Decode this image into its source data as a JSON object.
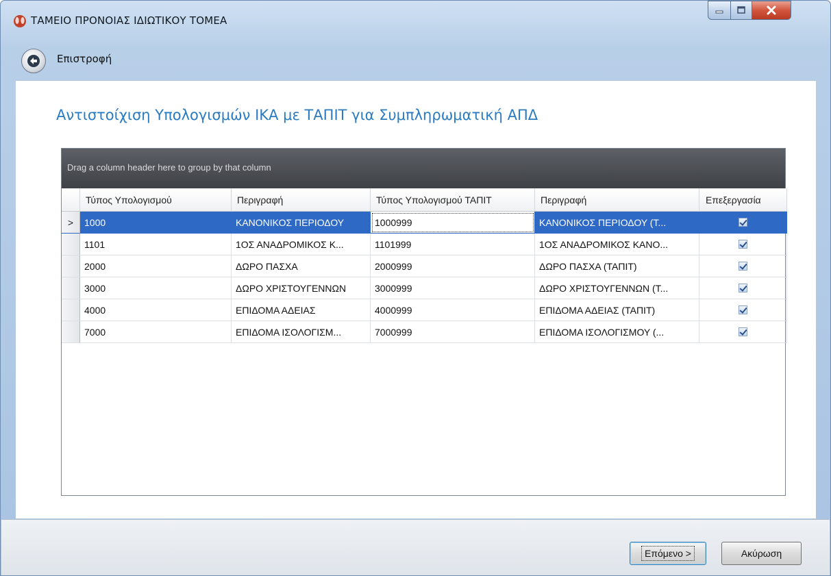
{
  "window": {
    "title": "ΤΑΜΕΙΟ ΠΡΟΝΟΙΑΣ ΙΔΙΩΤΙΚΟΥ ΤΟΜΕΑ",
    "icon": "app-logo-icon",
    "controls": {
      "minimize": "minimize-icon",
      "maximize": "maximize-icon",
      "close": "close-icon"
    }
  },
  "nav": {
    "back_label": "Επιστροφή",
    "back_icon": "back-arrow-icon"
  },
  "page": {
    "heading": "Αντιστοίχιση Υπολογισμών ΙΚΑ με ΤΑΠΙΤ για Συμπληρωματική  ΑΠΔ"
  },
  "grid": {
    "group_panel_text": "Drag a column header here to group by that column",
    "columns": [
      "Τύπος Υπολογισμού",
      "Περιγραφή",
      "Τύπος Υπολογισμού  ΤΑΠΙΤ",
      "Περιγραφή",
      "Επεξεργασία"
    ],
    "selected_row_indicator": ">",
    "rows": [
      {
        "code": "1000",
        "desc": "ΚΑΝΟΝΙΚΟΣ ΠΕΡΙΟΔΟΥ",
        "tapit_code": "1000999",
        "tapit_desc": "ΚΑΝΟΝΙΚΟΣ ΠΕΡΙΟΔΟΥ (Τ...",
        "edit": true
      },
      {
        "code": "1101",
        "desc": "1ΟΣ ΑΝΑΔΡΟΜΙΚΟΣ Κ...",
        "tapit_code": "1101999",
        "tapit_desc": "1ΟΣ ΑΝΑΔΡΟΜΙΚΟΣ ΚΑΝΟ...",
        "edit": true
      },
      {
        "code": "2000",
        "desc": "ΔΩΡΟ ΠΑΣΧΑ",
        "tapit_code": "2000999",
        "tapit_desc": "ΔΩΡΟ ΠΑΣΧΑ (ΤΑΠΙΤ)",
        "edit": true
      },
      {
        "code": "3000",
        "desc": "ΔΩΡΟ ΧΡΙΣΤΟΥΓΕΝΝΩΝ",
        "tapit_code": "3000999",
        "tapit_desc": "ΔΩΡΟ ΧΡΙΣΤΟΥΓΕΝΝΩΝ (Τ...",
        "edit": true
      },
      {
        "code": "4000",
        "desc": "ΕΠΙΔΟΜΑ ΑΔΕΙΑΣ",
        "tapit_code": "4000999",
        "tapit_desc": "ΕΠΙΔΟΜΑ ΑΔΕΙΑΣ (ΤΑΠΙΤ)",
        "edit": true
      },
      {
        "code": "7000",
        "desc": "ΕΠΙΔΟΜΑ ΙΣΟΛΟΓΙΣΜ...",
        "tapit_code": "7000999",
        "tapit_desc": "ΕΠΙΔΟΜΑ ΙΣΟΛΟΓΙΣΜΟΥ (...",
        "edit": true
      }
    ]
  },
  "footer": {
    "next_label": "Επόμενο >",
    "cancel_label": "Ακύρωση"
  },
  "colors": {
    "heading": "#2a7bc2",
    "selected_row": "#2f69c6",
    "group_panel": "#4a4d52"
  }
}
